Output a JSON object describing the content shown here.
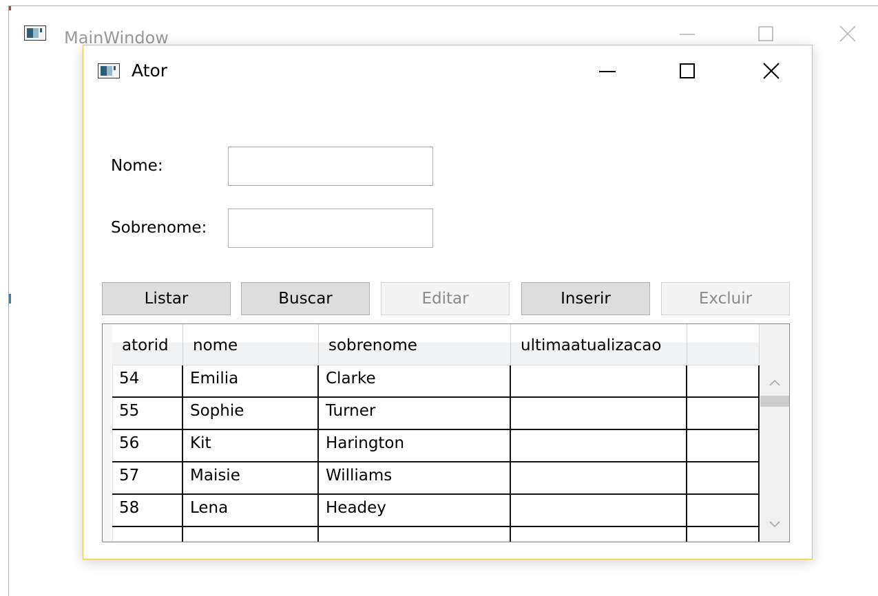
{
  "main_window": {
    "title": "MainWindow"
  },
  "dialog": {
    "title": "Ator",
    "fields": {
      "nome_label": "Nome:",
      "nome_value": "",
      "sobrenome_label": "Sobrenome:",
      "sobrenome_value": ""
    },
    "buttons": [
      {
        "label": "Listar",
        "enabled": true
      },
      {
        "label": "Buscar",
        "enabled": true
      },
      {
        "label": "Editar",
        "enabled": false
      },
      {
        "label": "Inserir",
        "enabled": true
      },
      {
        "label": "Excluir",
        "enabled": false
      }
    ],
    "grid": {
      "columns": [
        "atorid",
        "nome",
        "sobrenome",
        "ultimaatualizacao",
        ""
      ],
      "rows": [
        [
          "54",
          "Emilia",
          "Clarke",
          "",
          ""
        ],
        [
          "55",
          "Sophie",
          "Turner",
          "",
          ""
        ],
        [
          "56",
          "Kit",
          "Harington",
          "",
          ""
        ],
        [
          "57",
          "Maisie",
          "Williams",
          "",
          ""
        ],
        [
          "58",
          "Lena",
          "Headey",
          "",
          ""
        ],
        [
          "",
          "",
          "",
          "",
          ""
        ]
      ]
    }
  },
  "colors": {
    "dialog_border": "#e6c640",
    "button_enabled": "#dddddd",
    "button_disabled": "#f4f4f4",
    "disabled_text": "#8a8a8a"
  }
}
